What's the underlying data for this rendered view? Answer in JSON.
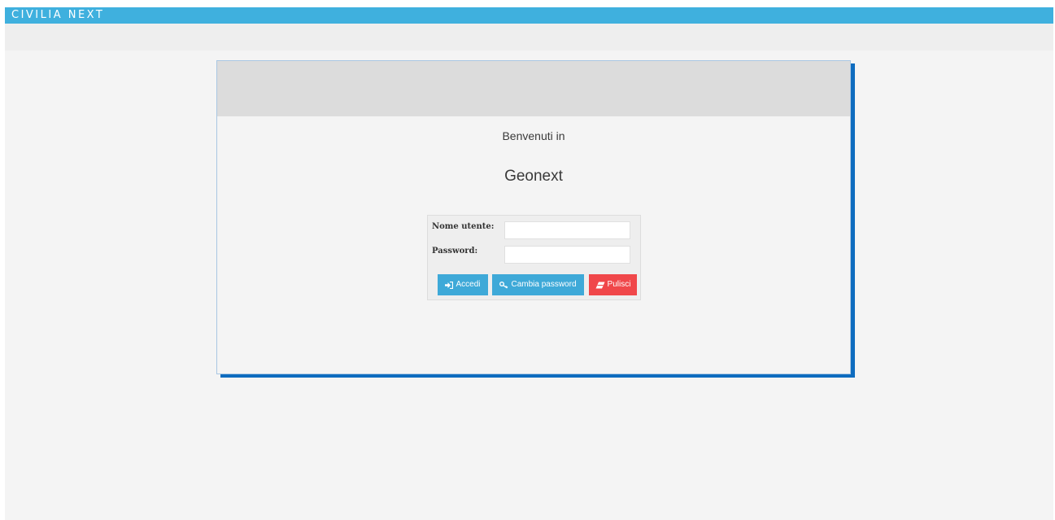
{
  "header": {
    "brand": "CIVILIA NEXT"
  },
  "welcome": {
    "line1": "Benvenuti in",
    "app_name": "Geonext"
  },
  "login": {
    "username_label": "Nome utente:",
    "username_value": "",
    "password_label": "Password:",
    "password_value": "",
    "buttons": {
      "login": "Accedi",
      "change_password": "Cambia password",
      "clear": "Pulisci"
    }
  },
  "colors": {
    "topbar": "#3fb0de",
    "primary_button": "#3ea9d8",
    "danger_button": "#f0474a",
    "card_shadow": "#0e6cbf"
  },
  "icons": {
    "login": "sign-in-icon",
    "change_password": "key-icon",
    "clear": "eraser-icon"
  }
}
